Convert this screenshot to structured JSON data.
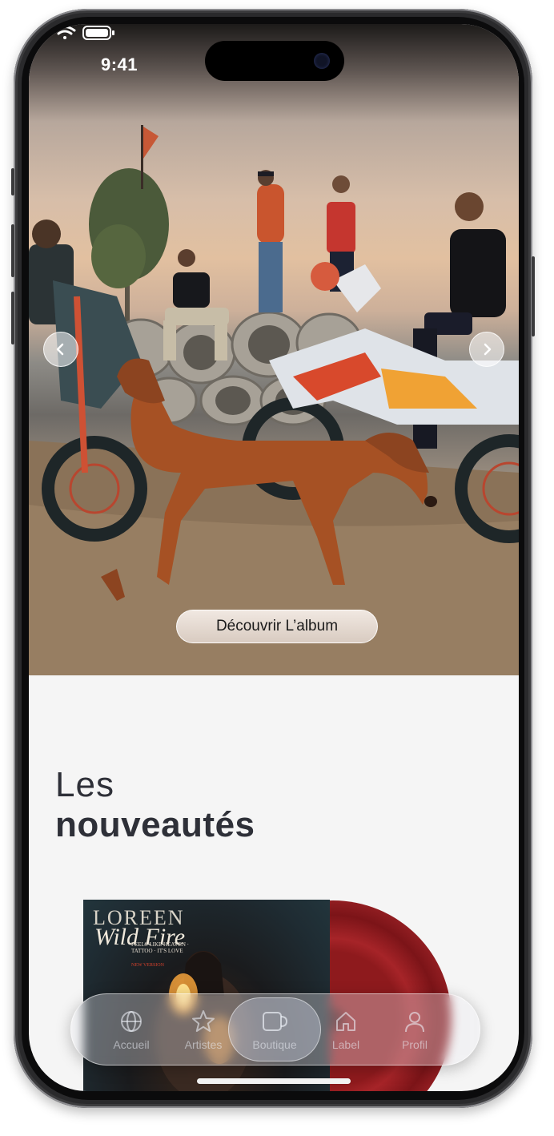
{
  "status_bar": {
    "time": "9:41"
  },
  "hero": {
    "cta_label": "Découvrir L’album"
  },
  "section": {
    "title_line1": "Les",
    "title_line2": "nouveautés"
  },
  "album": {
    "artist": "LOREEN",
    "title": "Wild Fire",
    "tracks": "FEELS LIKE HEAVEN · TATTOO · IT'S LOVE",
    "tag": "NEW VERSION"
  },
  "tabbar": {
    "items": [
      {
        "label": "Accueil",
        "icon": "globe-icon"
      },
      {
        "label": "Artistes",
        "icon": "star-icon"
      },
      {
        "label": "Boutique",
        "icon": "mug-icon",
        "active": true
      },
      {
        "label": "Label",
        "icon": "home-icon"
      },
      {
        "label": "Profil",
        "icon": "person-icon"
      }
    ]
  },
  "colors": {
    "title_text": "#2e3038",
    "content_bg": "#f5f5f5",
    "vinyl_red": "#8e1a1d"
  }
}
